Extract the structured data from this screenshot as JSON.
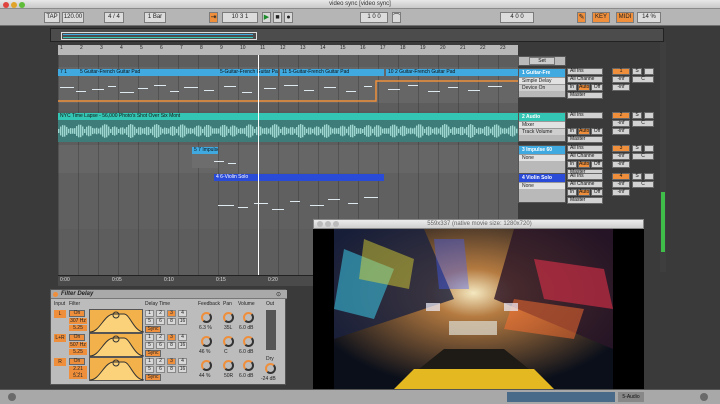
{
  "window": {
    "title": "video sync  [video sync]"
  },
  "transport": {
    "tap": "TAP",
    "tempo": "120.00",
    "signature": "4 / 4",
    "quantize": "1 Bar",
    "position": "10   3   1",
    "loop_start": "1   0   0",
    "loop_length": "4   0   0",
    "key_label": "KEY",
    "midi_label": "MIDI",
    "cpu": "14 %"
  },
  "ruler": {
    "ticks": [
      "1",
      "2",
      "3",
      "4",
      "5",
      "6",
      "7",
      "8",
      "9",
      "10",
      "11",
      "12",
      "13",
      "14",
      "15",
      "16",
      "17",
      "18",
      "19",
      "20",
      "21",
      "22",
      "23"
    ]
  },
  "scene": {
    "label": "Set"
  },
  "clips": [
    {
      "label": "7 1",
      "track": 0
    },
    {
      "label": "5 Guitar-French Guitar Pad",
      "track": 0
    },
    {
      "label": "5-Guitar-French Guitar Pad",
      "track": 0
    },
    {
      "label": "11 5-Guitar-French Guitar Pad",
      "track": 0
    },
    {
      "label": "10 2 Guitar-French Guitar Pad",
      "track": 0
    },
    {
      "label": "NYC Time Lapse - 56,000 Photo's Shot Over Six Mont",
      "track": 1
    },
    {
      "label": "5 7 Impulse",
      "track": 2
    },
    {
      "label": "4 6-Violin Solo",
      "track": 3
    }
  ],
  "tracks": [
    {
      "name": "1 Guitar-Fre",
      "color": "#3fa9e0",
      "io_from": "All Ins",
      "io_ch": "All Channe",
      "io_mon_in": "In",
      "io_mon_auto": "Auto",
      "io_mon_off": "Off",
      "io_to": "Master",
      "num": "1",
      "vol": "-inf",
      "pan": "-inf",
      "solo": "S",
      "c": "C",
      "devices": [
        "Simple Delay",
        "Device On"
      ]
    },
    {
      "name": "2 Audio",
      "color": "#34c6b4",
      "io_from": "All Ins",
      "io_ch": "",
      "io_mon_in": "In",
      "io_mon_auto": "Auto",
      "io_mon_off": "Off",
      "io_to": "Master",
      "num": "2",
      "vol": "-inf",
      "pan": "-inf",
      "solo": "S",
      "c": "C",
      "devices": [
        "Mixer",
        "Track Volume"
      ]
    },
    {
      "name": "3 Impulse 60",
      "color": "#3fa9e0",
      "io_from": "All Ins",
      "io_ch": "All Channe",
      "io_mon_in": "In",
      "io_mon_auto": "Auto",
      "io_mon_off": "Off",
      "io_to": "Master",
      "num": "3",
      "vol": "-inf",
      "pan": "-inf",
      "solo": "S",
      "c": "C",
      "devices": [
        "None"
      ]
    },
    {
      "name": "4 Violin Solo",
      "color": "#2a4bd8",
      "io_from": "All Ins",
      "io_ch": "All Channe",
      "io_mon_in": "In",
      "io_mon_auto": "Auto",
      "io_mon_off": "Off",
      "io_to": "Master",
      "num": "4",
      "vol": "-inf",
      "pan": "-inf",
      "solo": "S",
      "c": "C",
      "devices": [
        "None"
      ]
    }
  ],
  "timestrip": {
    "ticks": [
      "0:00",
      "0:05",
      "0:10",
      "0:15",
      "0:20"
    ]
  },
  "device": {
    "title": "Filter Delay",
    "input_label": "Input",
    "filter_label": "Filter",
    "delay_label": "Delay Time",
    "feedback_label": "Feedback",
    "pan_label": "Pan",
    "volume_label": "Volume",
    "out_label": "Out",
    "rows": [
      {
        "ch": "L",
        "on": "On",
        "freq": "307 Hz",
        "q": "5.25",
        "sync": "Sync",
        "feedback": "6.3 %",
        "pan": "35L",
        "volume": "6.0 dB"
      },
      {
        "ch": "L+R",
        "on": "On",
        "freq": "507 Hz",
        "q": "5.25",
        "sync": "Sync",
        "feedback": "46 %",
        "pan": "C",
        "volume": "6.0 dB"
      },
      {
        "ch": "R",
        "on": "On",
        "freq": "2.21 kHz",
        "q": "5.21",
        "sync": "Sync",
        "feedback": "44 %",
        "pan": "50R",
        "volume": "6.0 dB"
      }
    ],
    "delay_nums_top": [
      "1",
      "2",
      "3",
      "4"
    ],
    "delay_nums_bot": [
      "5",
      "6",
      "8",
      "16"
    ],
    "dry_label": "Dry",
    "dry_value": "-24 dB"
  },
  "video": {
    "title": "559x337 (native movie size: 1280x720)"
  },
  "status": {
    "track": "5-Audio"
  },
  "colors": {
    "accent": "#ef8f3c",
    "clip_blue": "#3fa9e0",
    "clip_teal": "#34c6b4",
    "clip_violin": "#2a4bd8"
  }
}
